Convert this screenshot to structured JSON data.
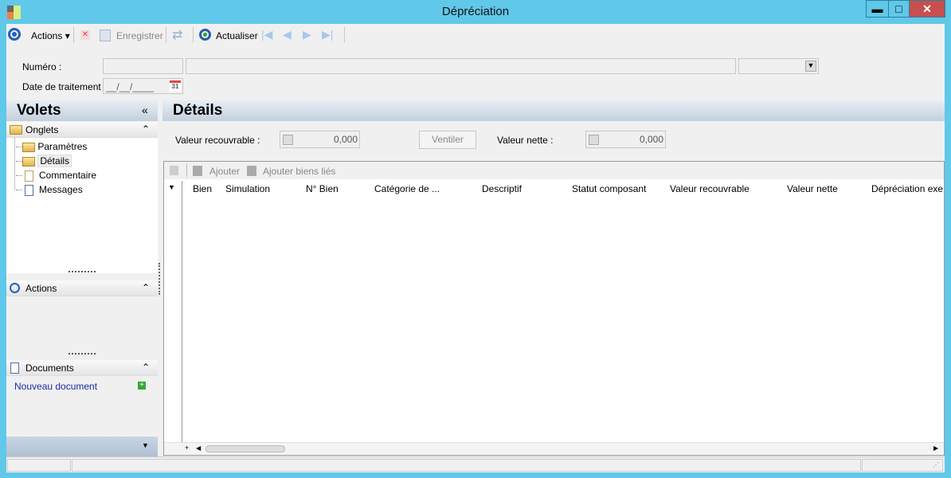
{
  "window": {
    "title": "Dépréciation",
    "minimize": "▬",
    "maximize": "□",
    "close": "✕"
  },
  "toolbar": {
    "actions": "Actions",
    "save": "Enregistrer",
    "refresh": "Actualiser"
  },
  "form": {
    "numero_label": "Numéro :",
    "date_label": "Date de traitement :",
    "date_value": "__/__/____",
    "calendar_day": "31"
  },
  "sidebar": {
    "title": "Volets",
    "collapse": "«",
    "onglets": {
      "title": "Onglets",
      "items": [
        {
          "label": "Paramètres"
        },
        {
          "label": "Détails"
        },
        {
          "label": "Commentaire"
        },
        {
          "label": "Messages"
        }
      ]
    },
    "actions": {
      "title": "Actions"
    },
    "documents": {
      "title": "Documents",
      "new_doc": "Nouveau document"
    }
  },
  "details": {
    "title": "Détails",
    "valeur_recouvrable_label": "Valeur recouvrable :",
    "valeur_recouvrable": "0,000",
    "ventiler": "Ventiler",
    "valeur_nette_label": "Valeur nette :",
    "valeur_nette": "0,000",
    "grid_toolbar": {
      "add": "Ajouter",
      "add_linked": "Ajouter biens liés"
    },
    "columns": [
      "Bien",
      "Simulation",
      "N° Bien",
      "Catégorie de ...",
      "Descriptif",
      "Statut composant",
      "Valeur recouvrable",
      "Valeur nette",
      "Dépréciation exe"
    ]
  }
}
